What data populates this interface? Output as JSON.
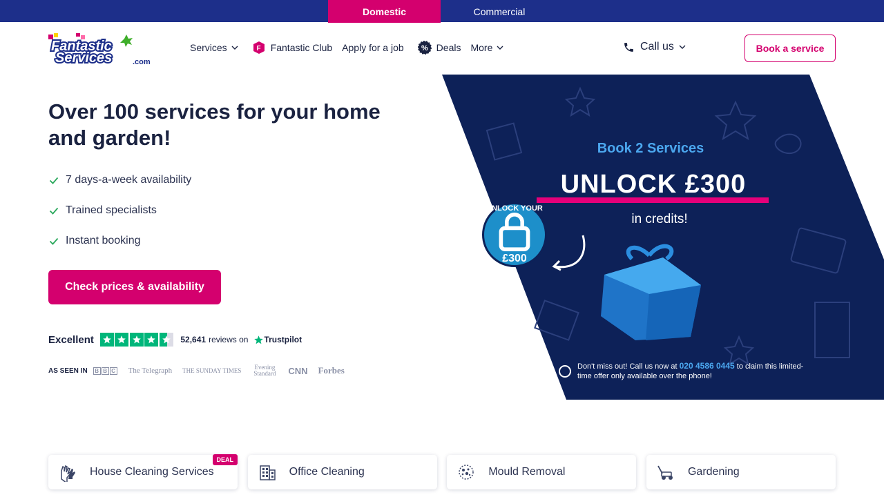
{
  "topbar": {
    "domestic": "Domestic",
    "commercial": "Commercial"
  },
  "header": {
    "logo_text": "Fantastic Services.com",
    "nav": {
      "services": "Services",
      "club": "Fantastic Club",
      "apply": "Apply for a job",
      "deals": "Deals",
      "more": "More"
    },
    "call_us": "Call us",
    "book": "Book a service"
  },
  "hero": {
    "title": "Over 100 services for your home and garden!",
    "features": [
      "7 days-a-week availability",
      "Trained specialists",
      "Instant booking"
    ],
    "cta": "Check prices & availability"
  },
  "trustpilot": {
    "rating_word": "Excellent",
    "reviews_count": "52,641",
    "reviews_on": "reviews on",
    "brand": "Trustpilot",
    "stars": 4.5
  },
  "as_seen_in": {
    "label": "AS SEEN IN",
    "outlets": [
      "BBC",
      "The Telegraph",
      "THE SUNDAY TIMES",
      "Evening Standard",
      "CNN",
      "Forbes"
    ]
  },
  "banner": {
    "headline": "Book 2 Services",
    "unlock": "UNLOCK £300",
    "credits": "in credits!",
    "badge_top": "UNLOCK YOUR",
    "badge_amount": "£300",
    "footer_pre": "Don't miss out! Call us now at",
    "phone": "020 4586 0445",
    "footer_post": "to claim this limited-time offer only available over the phone!"
  },
  "services": [
    {
      "label": "House Cleaning Services",
      "badge": "DEAL",
      "icon": "gloves-icon"
    },
    {
      "label": "Office Cleaning",
      "icon": "office-building-icon"
    },
    {
      "label": "Mould Removal",
      "icon": "mould-icon"
    },
    {
      "label": "Gardening",
      "icon": "lawn-mower-icon"
    }
  ],
  "colors": {
    "brand_pink": "#d4006e",
    "topbar_blue": "#1d2f8a",
    "banner_navy": "#0d2158",
    "trustpilot_green": "#00b67a"
  }
}
